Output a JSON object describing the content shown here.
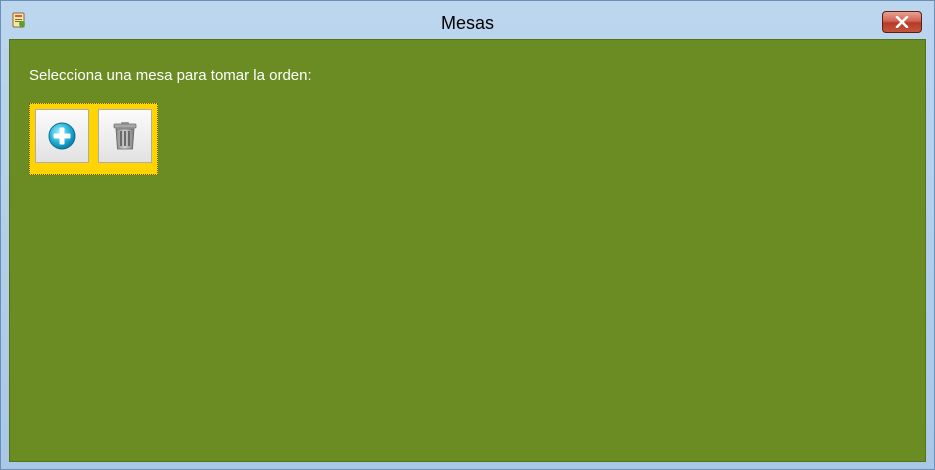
{
  "window": {
    "title": "Mesas"
  },
  "main": {
    "prompt": "Selecciona una mesa para tomar la orden:"
  },
  "toolbar": {
    "add_icon": "add-circle-icon",
    "delete_icon": "trash-icon"
  },
  "colors": {
    "background": "#6a8c22",
    "panel": "#ffd400",
    "close_button": "#c4463a"
  }
}
